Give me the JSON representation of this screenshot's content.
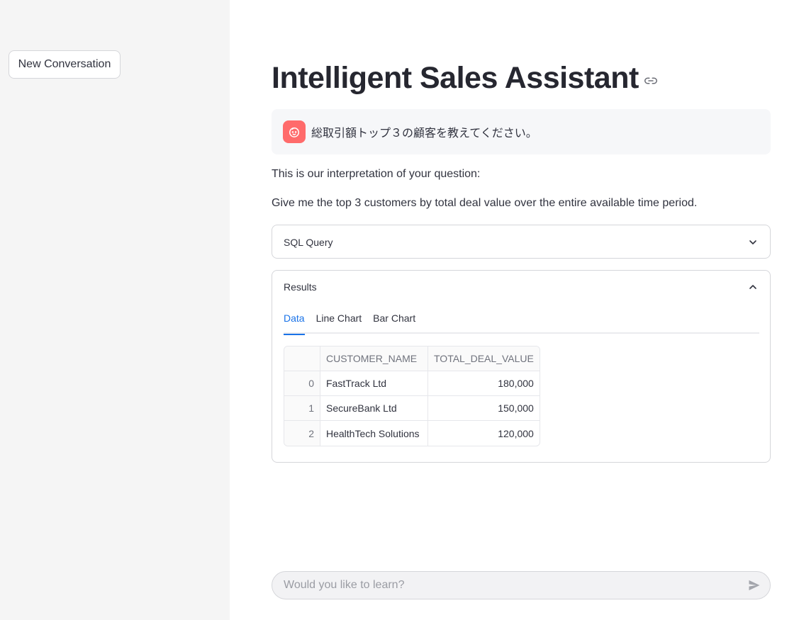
{
  "sidebar": {
    "new_conversation_label": "New Conversation"
  },
  "main": {
    "title": "Intelligent Sales Assistant",
    "title_link_icon": "link-icon",
    "user_message": {
      "avatar_icon": "user-avatar-icon",
      "avatar_color": "#ff6b6b",
      "text": "総取引額トップ３の顧客を教えてください。"
    },
    "interpretation_intro": "This is our interpretation of your question:",
    "interpretation": "Give me the top 3 customers by total deal value over the entire available time period.",
    "sql_expander": {
      "title": "SQL Query",
      "expanded": false,
      "icon": "chevron-down-icon"
    },
    "results_expander": {
      "title": "Results",
      "expanded": true,
      "icon": "chevron-up-icon",
      "tabs": [
        {
          "label": "Data",
          "active": true
        },
        {
          "label": "Line Chart",
          "active": false
        },
        {
          "label": "Bar Chart",
          "active": false
        }
      ],
      "table": {
        "columns": [
          "",
          "CUSTOMER_NAME",
          "TOTAL_DEAL_VALUE"
        ],
        "rows": [
          {
            "index": "0",
            "customer_name": "FastTrack Ltd",
            "total_deal_value": "180,000"
          },
          {
            "index": "1",
            "customer_name": "SecureBank Ltd",
            "total_deal_value": "150,000"
          },
          {
            "index": "2",
            "customer_name": "HealthTech Solutions",
            "total_deal_value": "120,000"
          }
        ]
      }
    },
    "chat_input": {
      "placeholder": "Would you like to learn?",
      "value": "",
      "send_icon": "send-icon"
    }
  },
  "colors": {
    "accent": "#1a73e8",
    "sidebar_bg": "#f5f5f5",
    "avatar": "#ff6b6b"
  }
}
